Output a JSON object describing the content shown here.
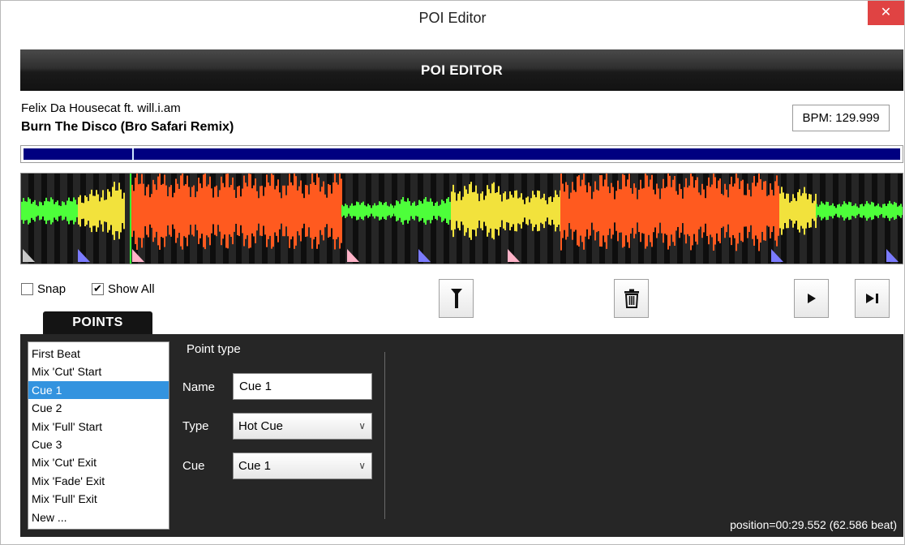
{
  "window": {
    "title": "POI Editor",
    "close_glyph": "✕"
  },
  "header": {
    "title": "POI EDITOR"
  },
  "track": {
    "artist": "Felix Da Housecat ft. will.i.am",
    "title": "Burn The Disco (Bro Safari Remix)",
    "bpm": "BPM: 129.999"
  },
  "overview": {
    "playhead_fraction": 0.124
  },
  "options": {
    "snap_label": "Snap",
    "snap_checked": false,
    "show_all_label": "Show All",
    "show_all_checked": true
  },
  "tools": {
    "add_point": "add-marker-icon",
    "delete_point": "trash-icon",
    "play": "play-icon",
    "play_to_next": "skip-next-icon"
  },
  "points_tab": {
    "label": "POINTS"
  },
  "points": [
    "First Beat",
    "Mix 'Cut' Start",
    "Cue 1",
    "Cue 2",
    "Mix 'Full' Start",
    "Cue 3",
    "Mix 'Cut' Exit",
    "Mix 'Fade' Exit",
    "Mix 'Full' Exit",
    "New ..."
  ],
  "selected_point": "Cue 1",
  "point_editor": {
    "heading": "Point type",
    "name_label": "Name",
    "name_value": "Cue 1",
    "type_label": "Type",
    "type_value": "Hot Cue",
    "cue_label": "Cue",
    "cue_value": "Cue 1"
  },
  "status": {
    "position": "position=00:29.552 (62.586 beat)"
  },
  "colors": {
    "overview_bar": "#000080",
    "selection": "#3393df",
    "wave_hot": "#ff5a1f",
    "wave_mid": "#f2e23c",
    "wave_low": "#4dff3a",
    "marker_grey": "#c8c8c8",
    "marker_blue": "#7b7bff",
    "marker_pink": "#ffb3c8"
  }
}
